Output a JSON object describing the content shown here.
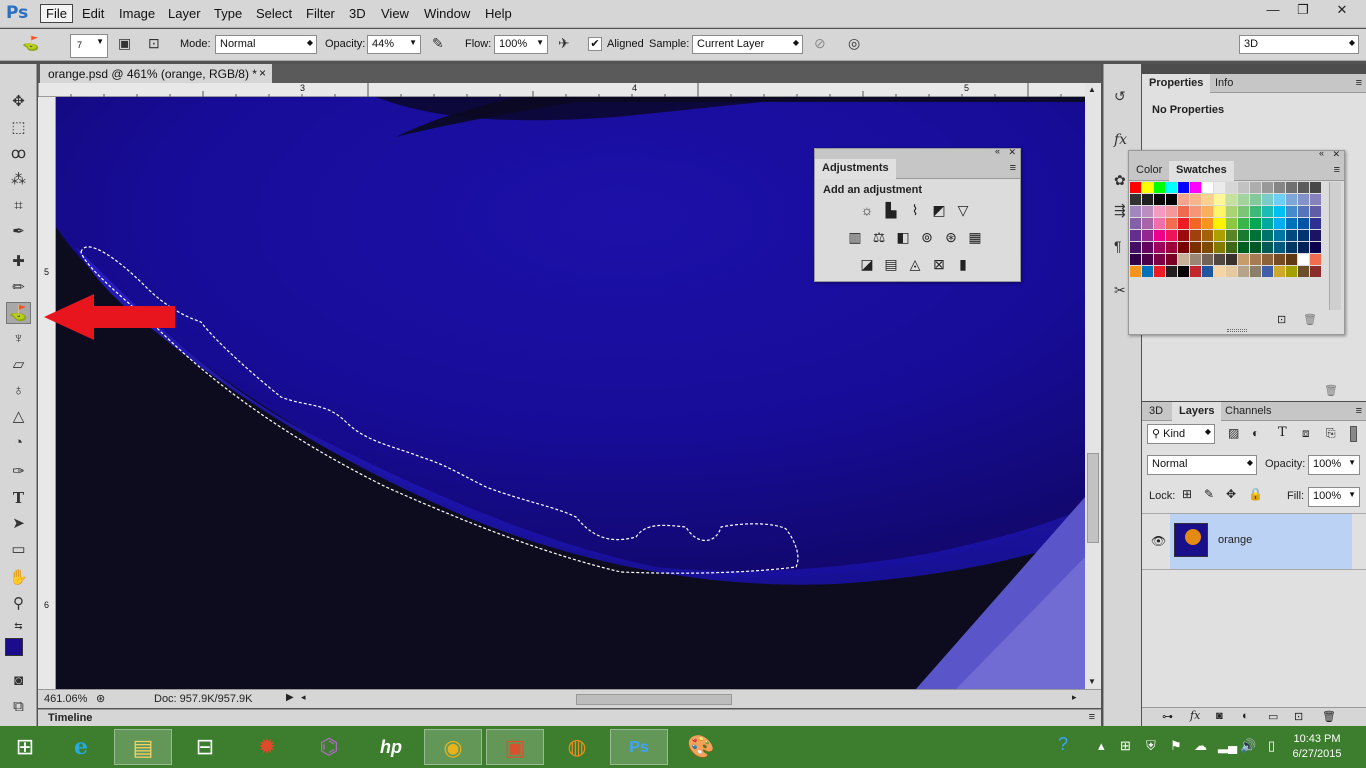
{
  "app": {
    "logo": "Ps"
  },
  "menu": [
    "File",
    "Edit",
    "Image",
    "Layer",
    "Type",
    "Select",
    "Filter",
    "3D",
    "View",
    "Window",
    "Help"
  ],
  "window_buttons": {
    "minimize": "—",
    "restore": "❐",
    "close": "✕"
  },
  "options": {
    "brush_size": "7",
    "mode_label": "Mode:",
    "mode_value": "Normal",
    "opacity_label": "Opacity:",
    "opacity_value": "44%",
    "flow_label": "Flow:",
    "flow_value": "100%",
    "aligned_label": "Aligned",
    "aligned_checked": true,
    "sample_label": "Sample:",
    "sample_value": "Current Layer",
    "workspace": "3D"
  },
  "document": {
    "tab_title": "orange.psd @ 461% (orange, RGB/8) *",
    "close": "×",
    "ruler_top": [
      "3",
      "4",
      "5"
    ],
    "ruler_left": [
      "5",
      "6"
    ],
    "zoom": "461.06%",
    "doc_info": "Doc: 957.9K/957.9K"
  },
  "timeline": {
    "label": "Timeline"
  },
  "properties_panel": {
    "tabs": [
      "Properties",
      "Info"
    ],
    "content": "No Properties"
  },
  "adjustments_panel": {
    "tab": "Adjustments",
    "heading": "Add an adjustment",
    "icons_row1": [
      "brightness-icon",
      "levels-icon",
      "curves-icon",
      "exposure-icon",
      "vibrance-icon"
    ],
    "icons_row2": [
      "hue-saturation-icon",
      "color-balance-icon",
      "black-white-icon",
      "photo-filter-icon",
      "channel-mixer-icon",
      "color-lookup-icon"
    ],
    "icons_row3": [
      "invert-icon",
      "posterize-icon",
      "threshold-icon",
      "selective-color-icon",
      "gradient-map-icon"
    ]
  },
  "color_panel": {
    "tabs": [
      "Color",
      "Swatches"
    ],
    "swatches": [
      "#ff0000",
      "#ffff00",
      "#00ff00",
      "#00ffff",
      "#0000ff",
      "#ff00ff",
      "#ffffff",
      "#ebebeb",
      "#d6d6d6",
      "#c2c2c2",
      "#adadad",
      "#999999",
      "#858585",
      "#707070",
      "#5c5c5c",
      "#474747",
      "#333333",
      "#1f1f1f",
      "#0a0a0a",
      "#000000",
      "#f4a48a",
      "#f7b58c",
      "#fcd08f",
      "#fff799",
      "#c5e19f",
      "#a3d39c",
      "#82ca9c",
      "#7accc8",
      "#6dcff6",
      "#7da7d9",
      "#8393ca",
      "#8781bd",
      "#a187be",
      "#bc8dbf",
      "#f49ac1",
      "#f5989d",
      "#ef6b4f",
      "#f69679",
      "#fbaf5c",
      "#fff568",
      "#acd372",
      "#7cc576",
      "#3cb878",
      "#1cbbb4",
      "#00bff3",
      "#448ccb",
      "#5674b9",
      "#605ca8",
      "#8560a8",
      "#a864a8",
      "#f06eaa",
      "#f26c4f",
      "#ed1c24",
      "#f26522",
      "#f7941d",
      "#fff200",
      "#8dc63f",
      "#39b54a",
      "#00a651",
      "#00a99d",
      "#00aeef",
      "#0072bc",
      "#0054a6",
      "#2e3192",
      "#662d91",
      "#92278f",
      "#ec008c",
      "#ed145b",
      "#9e0b0f",
      "#a0410d",
      "#a36209",
      "#aba000",
      "#598527",
      "#1a7b30",
      "#007236",
      "#00746b",
      "#0076a3",
      "#004a80",
      "#003471",
      "#1b1464",
      "#440e62",
      "#630460",
      "#9e005d",
      "#9e0039",
      "#790000",
      "#7b2e00",
      "#7d4900",
      "#827b00",
      "#406618",
      "#005e20",
      "#005826",
      "#005952",
      "#005b7f",
      "#003663",
      "#002157",
      "#0d004c",
      "#32004b",
      "#4b0049",
      "#7b0046",
      "#7a0026",
      "#c7b299",
      "#998675",
      "#736357",
      "#534741",
      "#37302d",
      "#c69c6d",
      "#a67c52",
      "#8c6239",
      "#754c24",
      "#603913",
      "#ffffff",
      "#f26c4f",
      "#f7941d",
      "#0072bc",
      "#ed1c24",
      "#231f20",
      "#000000",
      "#c1272d",
      "#1e56a0",
      "#f5d5a5",
      "#e4c9a0",
      "#b5a489",
      "#8d7e6a",
      "#3f5fa8",
      "#cfa72c",
      "#a3a000",
      "#6b4e2a",
      "#8c2b2b"
    ]
  },
  "layers_panel": {
    "tabs": [
      "3D",
      "Layers",
      "Channels"
    ],
    "kind_label": "Kind",
    "blend_mode": "Normal",
    "opacity_label": "Opacity:",
    "opacity_value": "100%",
    "lock_label": "Lock:",
    "fill_label": "Fill:",
    "fill_value": "100%",
    "layers": [
      {
        "name": "orange",
        "visible": true
      }
    ]
  },
  "colors": {
    "foreground": "#1a0c8a",
    "background": "#ffffff",
    "accent": "#3a6fc5"
  },
  "taskbar": {
    "items": [
      "start-icon",
      "ie-icon",
      "file-explorer-icon",
      "store-icon",
      "photo-app-icon",
      "media-app-icon",
      "hp-icon",
      "chrome-icon",
      "powerpoint-icon",
      "firefox-icon",
      "photoshop-icon",
      "paint-icon"
    ],
    "time": "10:43 PM",
    "date": "6/27/2015"
  }
}
